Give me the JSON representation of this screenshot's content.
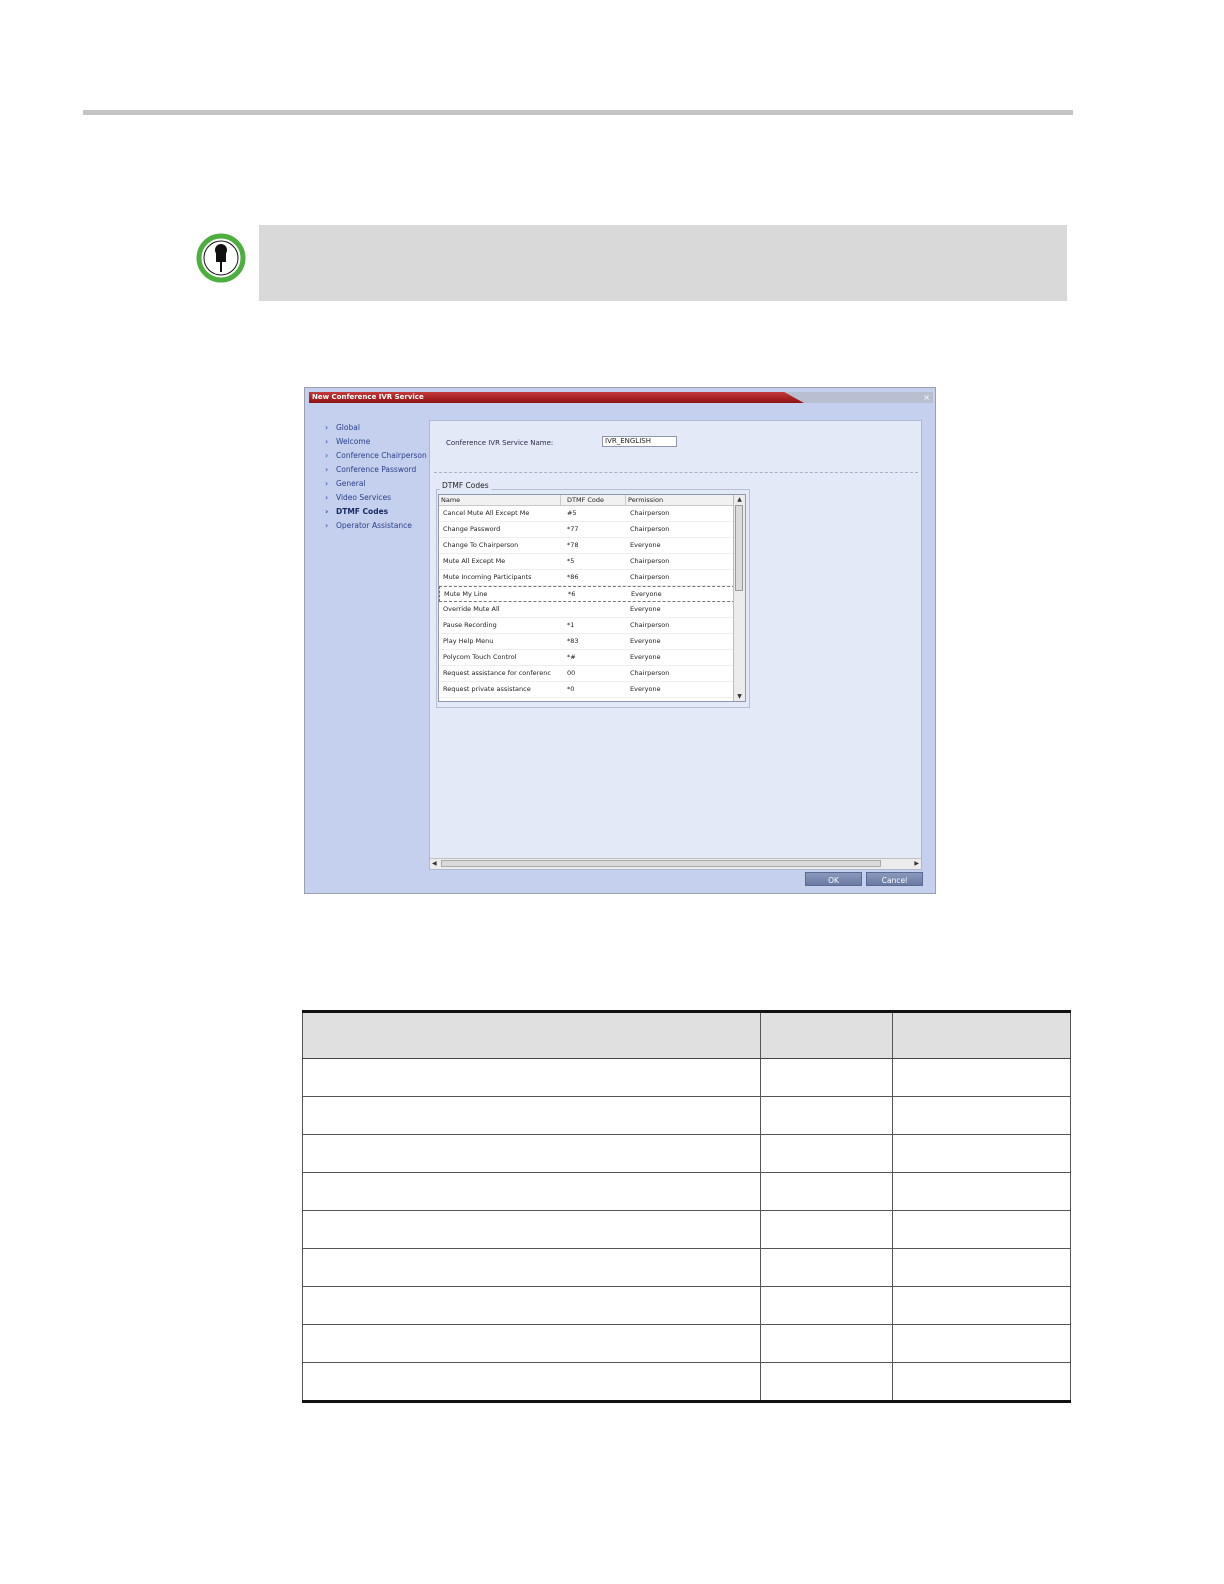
{
  "dialog": {
    "title": "New Conference IVR Service",
    "close_label": "×",
    "nav_items": [
      "Global",
      "Welcome",
      "Conference Chairperson",
      "Conference Password",
      "General",
      "Video Services",
      "DTMF Codes",
      "Operator Assistance"
    ],
    "active_nav": "DTMF Codes",
    "service_name_label": "Conference IVR Service Name:",
    "service_name_value": "IVR_ENGLISH",
    "dtmf_group_label": "DTMF Codes",
    "columns": [
      "Name",
      "DTMF Code",
      "Permission"
    ],
    "rows": [
      [
        "Cancel Mute All Except Me",
        "#5",
        "Chairperson"
      ],
      [
        "Change Password",
        "*77",
        "Chairperson"
      ],
      [
        "Change To Chairperson",
        "*78",
        "Everyone"
      ],
      [
        "Mute All Except Me",
        "*5",
        "Chairperson"
      ],
      [
        "Mute Incoming Participants",
        "*86",
        "Chairperson"
      ],
      [
        "Mute My Line",
        "*6",
        "Everyone"
      ],
      [
        "Override Mute All",
        "",
        "Everyone"
      ],
      [
        "Pause Recording",
        "*1",
        "Chairperson"
      ],
      [
        "Play Help Menu",
        "*83",
        "Everyone"
      ],
      [
        "Polycom Touch Control",
        "*#",
        "Everyone"
      ],
      [
        "Request assistance for conferenc",
        "00",
        "Chairperson"
      ],
      [
        "Request private assistance",
        "*0",
        "Everyone"
      ]
    ],
    "selected_row": "Mute My Line",
    "ok_label": "OK",
    "cancel_label": "Cancel"
  },
  "table": {
    "row_count": 9
  }
}
